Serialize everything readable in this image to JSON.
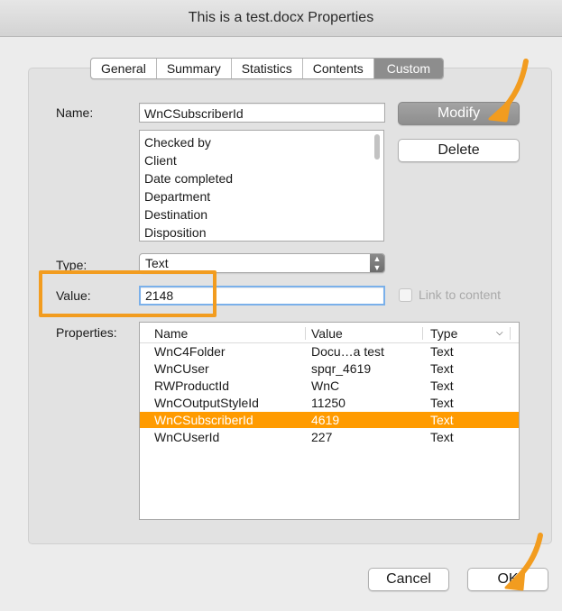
{
  "window": {
    "title": "This is a test.docx Properties"
  },
  "tabs": [
    {
      "label": "General"
    },
    {
      "label": "Summary"
    },
    {
      "label": "Statistics"
    },
    {
      "label": "Contents"
    },
    {
      "label": "Custom"
    }
  ],
  "form": {
    "name_label": "Name:",
    "name_value": "WnCSubscriberId",
    "name_options": [
      "Checked by",
      "Client",
      "Date completed",
      "Department",
      "Destination",
      "Disposition"
    ],
    "type_label": "Type:",
    "type_value": "Text",
    "value_label": "Value:",
    "value_value": "2148",
    "link_to_content_label": "Link to content",
    "properties_label": "Properties:"
  },
  "buttons": {
    "modify": "Modify",
    "delete": "Delete",
    "cancel": "Cancel",
    "ok": "OK"
  },
  "properties_table": {
    "headers": {
      "name": "Name",
      "value": "Value",
      "type": "Type"
    },
    "sort_icon": "chevron-down-icon",
    "rows": [
      {
        "name": "WnC4Folder",
        "value": "Docu…a test",
        "type": "Text"
      },
      {
        "name": "WnCUser",
        "value": "spqr_4619",
        "type": "Text"
      },
      {
        "name": "RWProductId",
        "value": "WnC",
        "type": "Text"
      },
      {
        "name": "WnCOutputStyleId",
        "value": "11250",
        "type": "Text"
      },
      {
        "name": "WnCSubscriberId",
        "value": "4619",
        "type": "Text",
        "selected": true
      },
      {
        "name": "WnCUserId",
        "value": "227",
        "type": "Text"
      }
    ]
  },
  "colors": {
    "accent": "#ff9b00",
    "annotation": "#f29c1f",
    "selected_tab": "#8d8d8d"
  }
}
